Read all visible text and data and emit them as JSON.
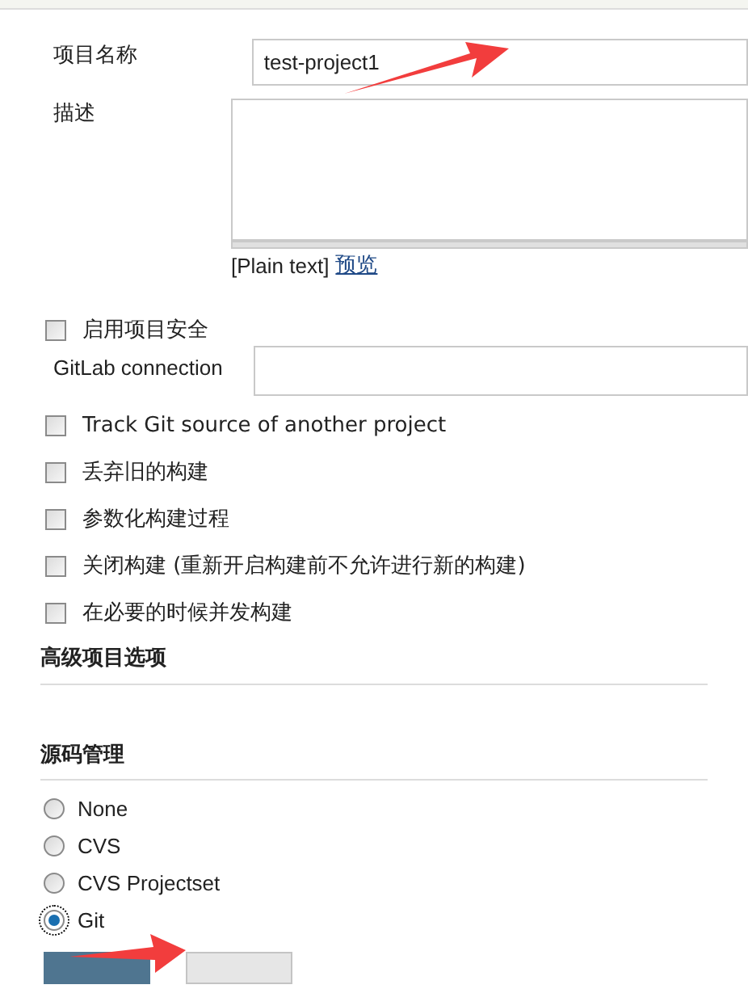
{
  "fields": [
    {
      "label": "项目名称",
      "value": "test-project1"
    },
    {
      "label": "描述"
    }
  ],
  "description_footer": {
    "format": "[Plain text]",
    "preview_link": "预览"
  },
  "security_option": {
    "label": "启用项目安全",
    "checked": false
  },
  "gitlab_connection": {
    "label": "GitLab connection"
  },
  "options": [
    {
      "label": "Track Git source of another project",
      "checked": false
    },
    {
      "label": "丢弃旧的构建",
      "checked": false
    },
    {
      "label": "参数化构建过程",
      "checked": false
    },
    {
      "label": "关闭构建 (重新开启构建前不允许进行新的构建)",
      "checked": false
    },
    {
      "label": "在必要的时候并发构建",
      "checked": false
    }
  ],
  "sections": [
    {
      "title": "高级项目选项"
    },
    {
      "title": "源码管理"
    }
  ],
  "scm": [
    {
      "label": "None",
      "selected": false
    },
    {
      "label": "CVS",
      "selected": false
    },
    {
      "label": "CVS Projectset",
      "selected": false
    },
    {
      "label": "Git",
      "selected": true
    }
  ]
}
